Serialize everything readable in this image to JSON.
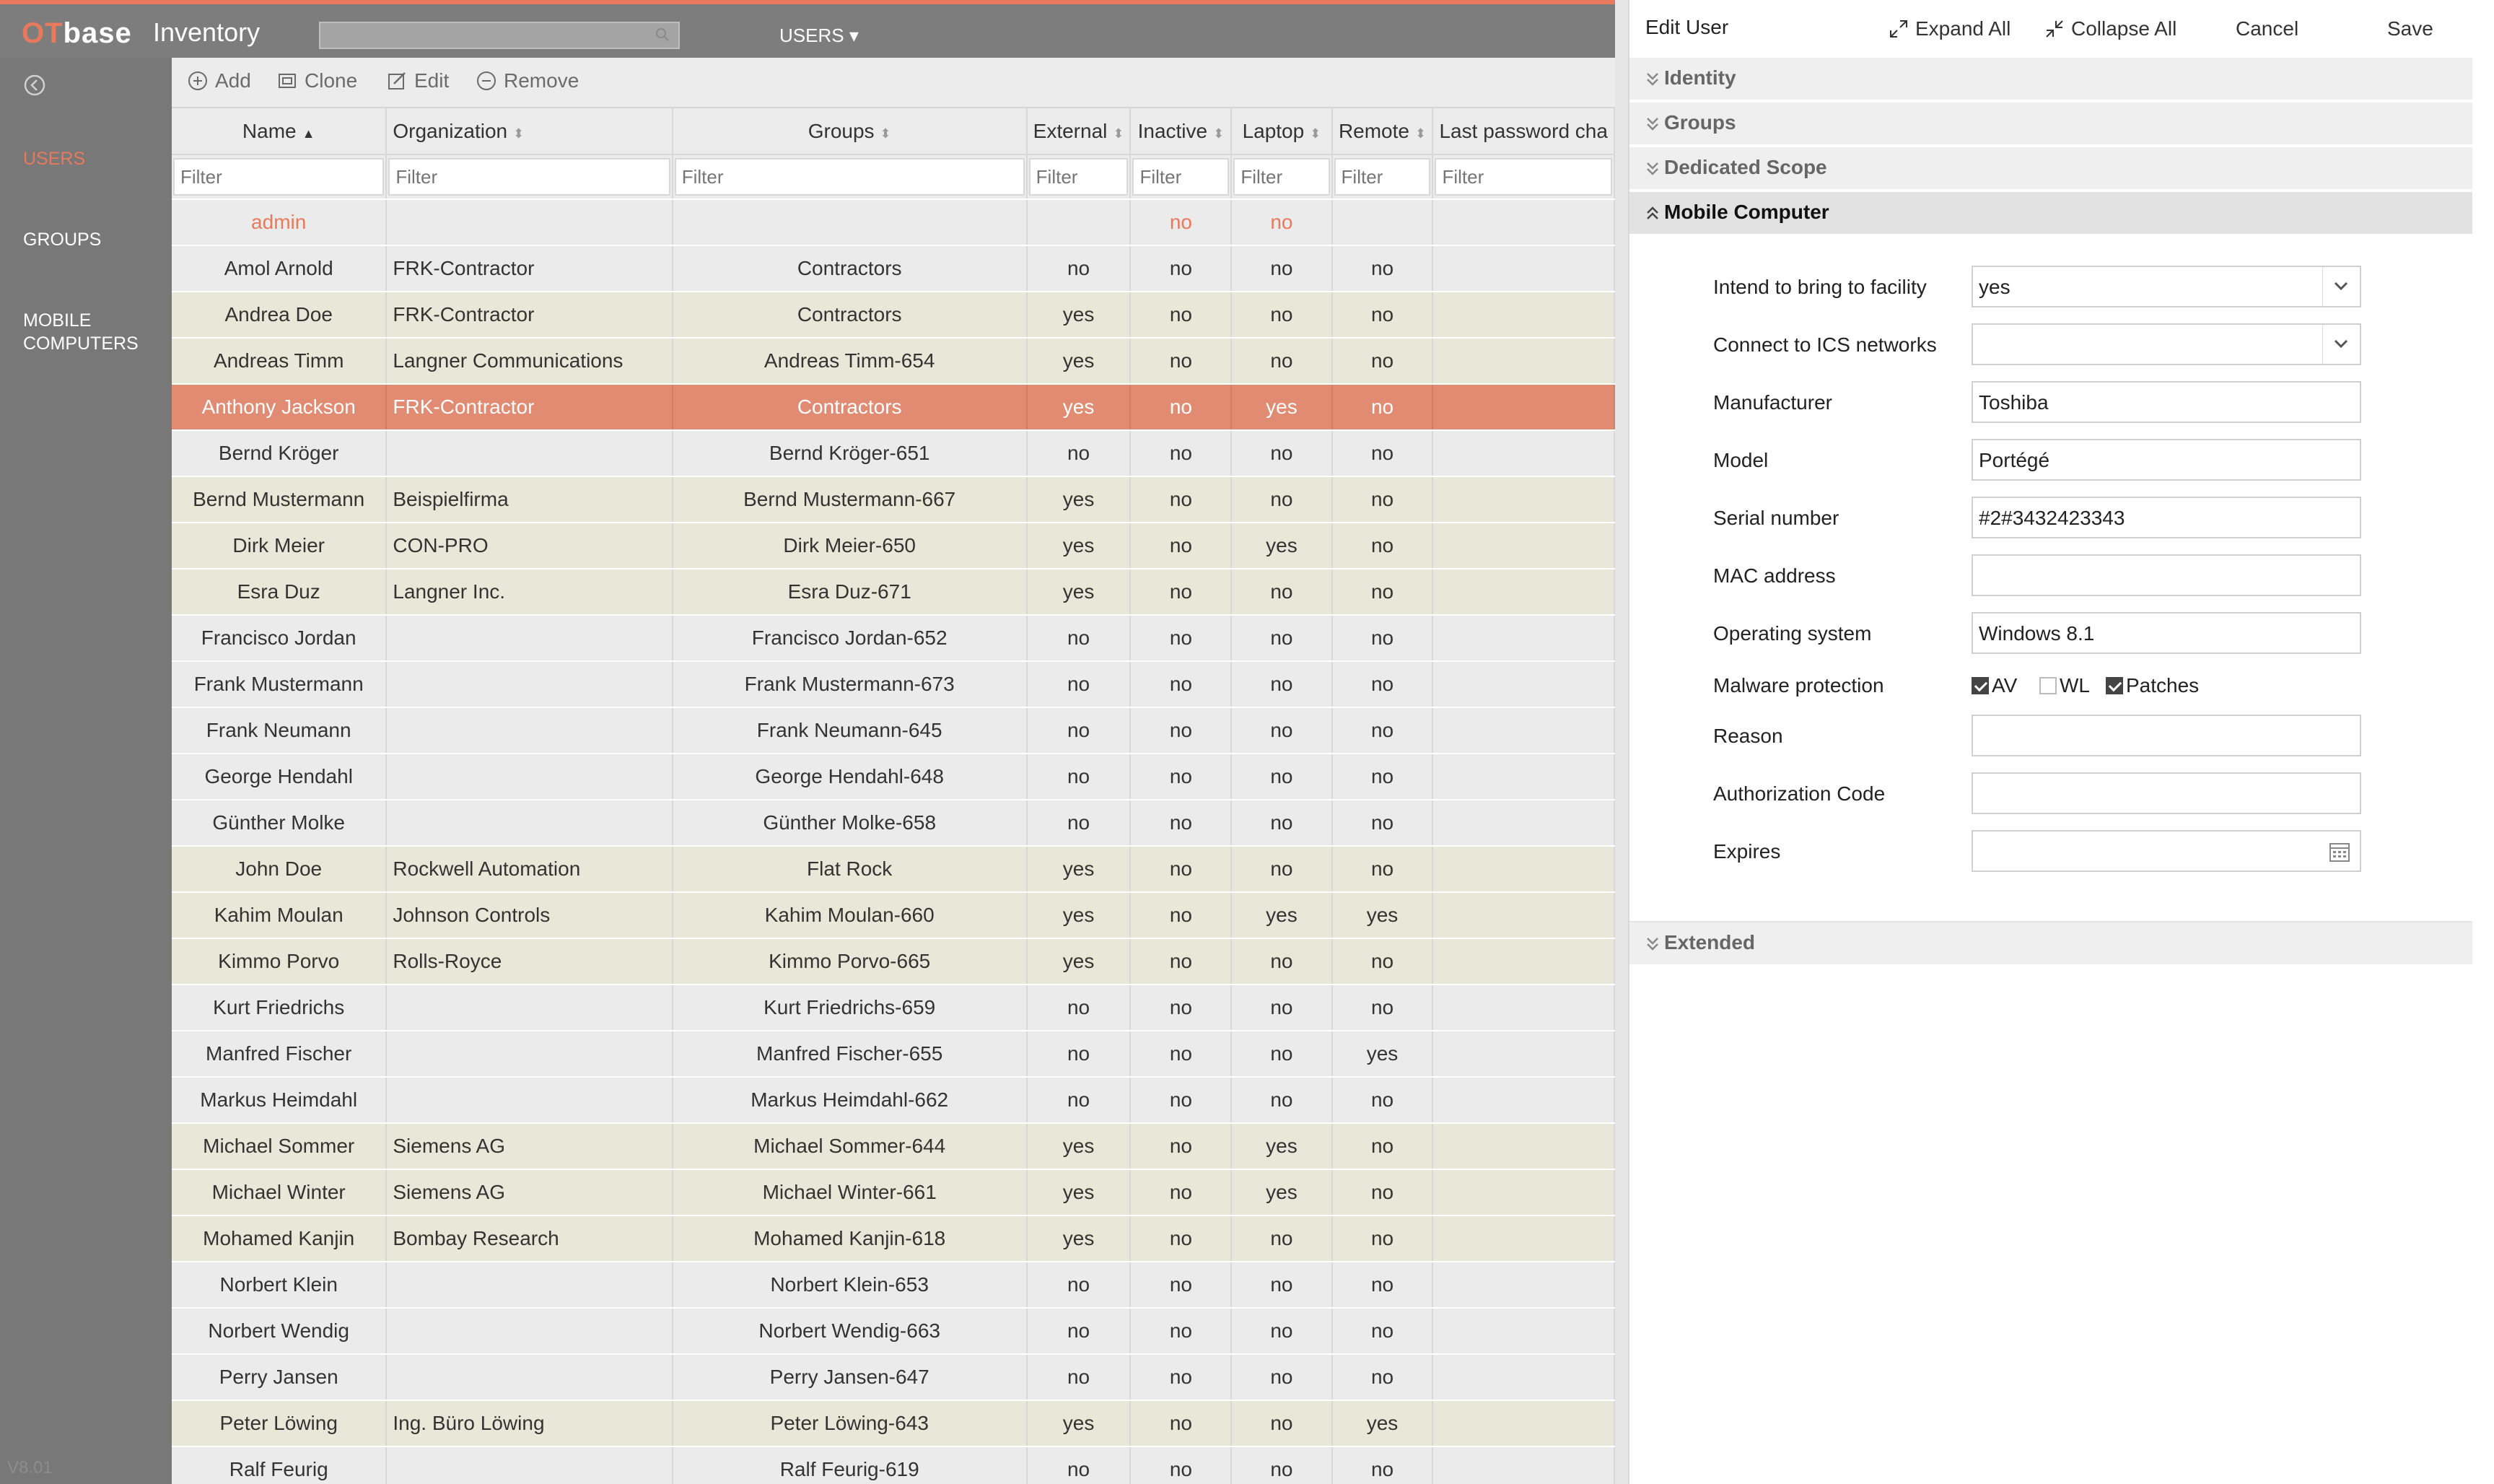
{
  "app": {
    "logo_ot": "OT",
    "logo_base": "base",
    "title": "Inventory",
    "menu": "USERS"
  },
  "sidebar": {
    "items": [
      {
        "label": "USERS"
      },
      {
        "label": "GROUPS"
      },
      {
        "label": "MOBILE\nCOMPUTERS"
      }
    ],
    "version": "V8.01"
  },
  "toolbar": {
    "add": "Add",
    "clone": "Clone",
    "edit": "Edit",
    "remove": "Remove"
  },
  "grid": {
    "columns": [
      "Name",
      "Organization",
      "Groups",
      "External",
      "Inactive",
      "Laptop",
      "Remote",
      "Last password cha"
    ],
    "filter_placeholder": "Filter",
    "rows": [
      {
        "name": "admin",
        "org": "",
        "groups": "",
        "ext": "",
        "inactive": "no",
        "laptop": "no",
        "remote": "",
        "type": "admin"
      },
      {
        "name": "Amol Arnold",
        "org": "FRK-Contractor",
        "groups": "Contractors",
        "ext": "no",
        "inactive": "no",
        "laptop": "no",
        "remote": "no",
        "type": "internal"
      },
      {
        "name": "Andrea Doe",
        "org": "FRK-Contractor",
        "groups": "Contractors",
        "ext": "yes",
        "inactive": "no",
        "laptop": "no",
        "remote": "no",
        "type": "external"
      },
      {
        "name": "Andreas Timm",
        "org": "Langner Communications",
        "groups": "Andreas Timm-654",
        "ext": "yes",
        "inactive": "no",
        "laptop": "no",
        "remote": "no",
        "type": "external"
      },
      {
        "name": "Anthony Jackson",
        "org": "FRK-Contractor",
        "groups": "Contractors",
        "ext": "yes",
        "inactive": "no",
        "laptop": "yes",
        "remote": "no",
        "type": "selected"
      },
      {
        "name": "Bernd Kröger",
        "org": "",
        "groups": "Bernd Kröger-651",
        "ext": "no",
        "inactive": "no",
        "laptop": "no",
        "remote": "no",
        "type": "internal"
      },
      {
        "name": "Bernd Mustermann",
        "org": "Beispielfirma",
        "groups": "Bernd Mustermann-667",
        "ext": "yes",
        "inactive": "no",
        "laptop": "no",
        "remote": "no",
        "type": "external"
      },
      {
        "name": "Dirk Meier",
        "org": "CON-PRO",
        "groups": "Dirk Meier-650",
        "ext": "yes",
        "inactive": "no",
        "laptop": "yes",
        "remote": "no",
        "type": "external"
      },
      {
        "name": "Esra Duz",
        "org": "Langner Inc.",
        "groups": "Esra Duz-671",
        "ext": "yes",
        "inactive": "no",
        "laptop": "no",
        "remote": "no",
        "type": "external"
      },
      {
        "name": "Francisco Jordan",
        "org": "",
        "groups": "Francisco Jordan-652",
        "ext": "no",
        "inactive": "no",
        "laptop": "no",
        "remote": "no",
        "type": "internal"
      },
      {
        "name": "Frank Mustermann",
        "org": "",
        "groups": "Frank Mustermann-673",
        "ext": "no",
        "inactive": "no",
        "laptop": "no",
        "remote": "no",
        "type": "internal"
      },
      {
        "name": "Frank Neumann",
        "org": "",
        "groups": "Frank Neumann-645",
        "ext": "no",
        "inactive": "no",
        "laptop": "no",
        "remote": "no",
        "type": "internal"
      },
      {
        "name": "George Hendahl",
        "org": "",
        "groups": "George Hendahl-648",
        "ext": "no",
        "inactive": "no",
        "laptop": "no",
        "remote": "no",
        "type": "internal"
      },
      {
        "name": "Günther Molke",
        "org": "",
        "groups": "Günther Molke-658",
        "ext": "no",
        "inactive": "no",
        "laptop": "no",
        "remote": "no",
        "type": "internal"
      },
      {
        "name": "John Doe",
        "org": "Rockwell Automation",
        "groups": "Flat Rock",
        "ext": "yes",
        "inactive": "no",
        "laptop": "no",
        "remote": "no",
        "type": "external"
      },
      {
        "name": "Kahim Moulan",
        "org": "Johnson Controls",
        "groups": "Kahim Moulan-660",
        "ext": "yes",
        "inactive": "no",
        "laptop": "yes",
        "remote": "yes",
        "type": "external"
      },
      {
        "name": "Kimmo Porvo",
        "org": "Rolls-Royce",
        "groups": "Kimmo Porvo-665",
        "ext": "yes",
        "inactive": "no",
        "laptop": "no",
        "remote": "no",
        "type": "external"
      },
      {
        "name": "Kurt Friedrichs",
        "org": "",
        "groups": "Kurt Friedrichs-659",
        "ext": "no",
        "inactive": "no",
        "laptop": "no",
        "remote": "no",
        "type": "internal"
      },
      {
        "name": "Manfred Fischer",
        "org": "",
        "groups": "Manfred Fischer-655",
        "ext": "no",
        "inactive": "no",
        "laptop": "no",
        "remote": "yes",
        "type": "internal"
      },
      {
        "name": "Markus Heimdahl",
        "org": "",
        "groups": "Markus Heimdahl-662",
        "ext": "no",
        "inactive": "no",
        "laptop": "no",
        "remote": "no",
        "type": "internal"
      },
      {
        "name": "Michael Sommer",
        "org": "Siemens AG",
        "groups": "Michael Sommer-644",
        "ext": "yes",
        "inactive": "no",
        "laptop": "yes",
        "remote": "no",
        "type": "external"
      },
      {
        "name": "Michael Winter",
        "org": "Siemens AG",
        "groups": "Michael Winter-661",
        "ext": "yes",
        "inactive": "no",
        "laptop": "yes",
        "remote": "no",
        "type": "external"
      },
      {
        "name": "Mohamed Kanjin",
        "org": "Bombay Research",
        "groups": "Mohamed Kanjin-618",
        "ext": "yes",
        "inactive": "no",
        "laptop": "no",
        "remote": "no",
        "type": "external"
      },
      {
        "name": "Norbert Klein",
        "org": "",
        "groups": "Norbert Klein-653",
        "ext": "no",
        "inactive": "no",
        "laptop": "no",
        "remote": "no",
        "type": "internal"
      },
      {
        "name": "Norbert Wendig",
        "org": "",
        "groups": "Norbert Wendig-663",
        "ext": "no",
        "inactive": "no",
        "laptop": "no",
        "remote": "no",
        "type": "internal"
      },
      {
        "name": "Perry Jansen",
        "org": "",
        "groups": "Perry Jansen-647",
        "ext": "no",
        "inactive": "no",
        "laptop": "no",
        "remote": "no",
        "type": "internal"
      },
      {
        "name": "Peter Löwing",
        "org": "Ing. Büro Löwing",
        "groups": "Peter Löwing-643",
        "ext": "yes",
        "inactive": "no",
        "laptop": "no",
        "remote": "yes",
        "type": "external"
      },
      {
        "name": "Ralf Feurig",
        "org": "",
        "groups": "Ralf Feurig-619",
        "ext": "no",
        "inactive": "no",
        "laptop": "no",
        "remote": "no",
        "type": "internal"
      }
    ]
  },
  "panel": {
    "title": "Edit User",
    "expand_all": "Expand All",
    "collapse_all": "Collapse All",
    "cancel": "Cancel",
    "save": "Save",
    "sections": [
      "Identity",
      "Groups",
      "Dedicated Scope",
      "Mobile Computer",
      "Extended"
    ],
    "fields": {
      "intend_label": "Intend to bring to facility",
      "intend_value": "yes",
      "connect_label": "Connect to ICS networks",
      "connect_value": "",
      "manufacturer_label": "Manufacturer",
      "manufacturer_value": "Toshiba",
      "model_label": "Model",
      "model_value": "Portégé",
      "serial_label": "Serial number",
      "serial_value": "#2#3432423343",
      "mac_label": "MAC address",
      "mac_value": "",
      "os_label": "Operating system",
      "os_value": "Windows 8.1",
      "malware_label": "Malware protection",
      "av_label": "AV",
      "av_checked": true,
      "wl_label": "WL",
      "wl_checked": false,
      "patches_label": "Patches",
      "patches_checked": true,
      "reason_label": "Reason",
      "reason_value": "",
      "auth_label": "Authorization Code",
      "auth_value": "",
      "expires_label": "Expires",
      "expires_value": ""
    }
  },
  "colors": {
    "accent": "#e8795c",
    "topbar": "#7d7d7d",
    "sidebar": "#787878",
    "selected_row": "#e28b73",
    "external_row": "#e8e8d8"
  }
}
